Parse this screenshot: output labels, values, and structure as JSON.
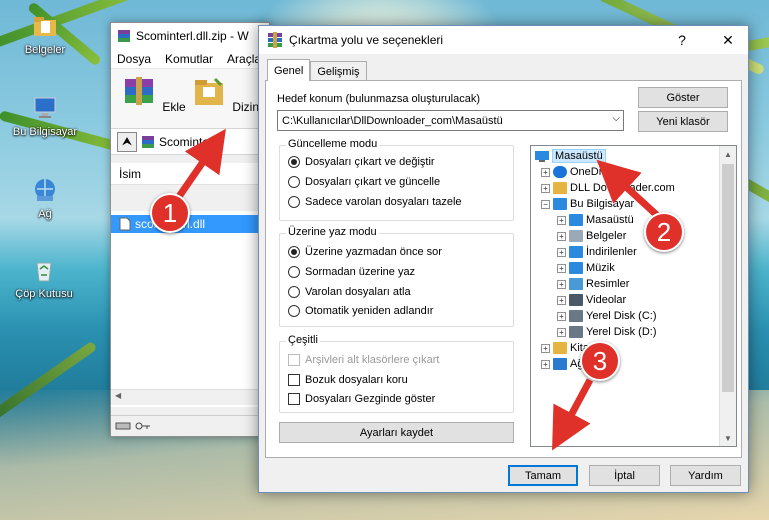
{
  "desktop": {
    "icons": [
      {
        "label": "Belgeler",
        "icon": "folder-icon"
      },
      {
        "label": "Bu Bilgisayar",
        "icon": "computer-icon"
      },
      {
        "label": "Ağ",
        "icon": "network-icon"
      },
      {
        "label": "Çöp Kutusu",
        "icon": "recycle-bin-icon"
      }
    ]
  },
  "winrar": {
    "title": "Scominterl.dll.zip - W",
    "menu": [
      "Dosya",
      "Komutlar",
      "Araçla"
    ],
    "toolbar": {
      "add_label": "Ekle",
      "extract_label": "Dizine Çıkart"
    },
    "address": "Scominterl.",
    "column_name": "İsim",
    "file": "scominterl.dll"
  },
  "dialog": {
    "title": "Çıkartma yolu ve seçenekleri",
    "help_glyph": "?",
    "close_glyph": "✕",
    "tabs": [
      "Genel",
      "Gelişmiş"
    ],
    "dest_label": "Hedef konum (bulunmazsa oluşturulacak)",
    "dest_value": "C:\\Kullanıcılar\\DllDownloader_com\\Masaüstü",
    "show_button": "Göster",
    "new_folder_button": "Yeni klasör",
    "update_group": {
      "title": "Güncelleme modu",
      "options": [
        "Dosyaları çıkart ve değiştir",
        "Dosyaları çıkart ve güncelle",
        "Sadece varolan dosyaları tazele"
      ],
      "selected": 0
    },
    "overwrite_group": {
      "title": "Üzerine yaz modu",
      "options": [
        "Üzerine yazmadan önce sor",
        "Sormadan üzerine yaz",
        "Varolan dosyaları atla",
        "Otomatik yeniden adlandır"
      ],
      "selected": 0
    },
    "misc_group": {
      "title": "Çeşitli",
      "options": [
        "Arşivleri alt klasörlere çıkart",
        "Bozuk dosyaları koru",
        "Dosyaları Gezginde göster"
      ]
    },
    "save_settings_button": "Ayarları kaydet",
    "tree": {
      "root": "Masaüstü",
      "items": [
        {
          "label": "OneDr",
          "level": 1,
          "icon": "cloud-icon"
        },
        {
          "label": "DLL Downloader.com",
          "level": 1,
          "icon": "user-folder-icon"
        },
        {
          "label": "Bu Bilgisayar",
          "level": 1,
          "icon": "computer-icon"
        },
        {
          "label": "Masaüstü",
          "level": 2,
          "icon": "desktop-icon"
        },
        {
          "label": "Belgeler",
          "level": 2,
          "icon": "documents-icon"
        },
        {
          "label": "İndirilenler",
          "level": 2,
          "icon": "download-icon"
        },
        {
          "label": "Müzik",
          "level": 2,
          "icon": "music-icon"
        },
        {
          "label": "Resimler",
          "level": 2,
          "icon": "pictures-icon"
        },
        {
          "label": "Videolar",
          "level": 2,
          "icon": "videos-icon"
        },
        {
          "label": "Yerel Disk (C:)",
          "level": 2,
          "icon": "drive-icon"
        },
        {
          "label": "Yerel Disk (D:)",
          "level": 2,
          "icon": "drive-icon"
        },
        {
          "label": "Kitapl",
          "level": 1,
          "icon": "library-icon"
        },
        {
          "label": "Ağ",
          "level": 1,
          "icon": "network-icon"
        }
      ]
    },
    "ok_button": "Tamam",
    "cancel_button": "İptal",
    "help_button": "Yardım"
  },
  "annotations": [
    "1",
    "2",
    "3"
  ],
  "colors": {
    "annotation": "#e0302a",
    "selection": "#cce8ff",
    "file_selection": "#3399ff",
    "default_button_border": "#0078d7"
  }
}
